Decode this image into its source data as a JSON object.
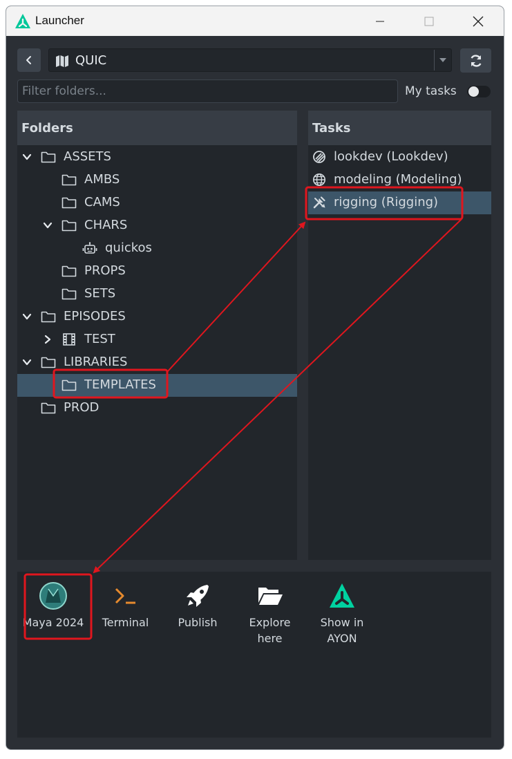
{
  "window": {
    "title": "Launcher"
  },
  "toolbar": {
    "project": "QUIC"
  },
  "filter": {
    "placeholder": "Filter folders...",
    "value": ""
  },
  "my_tasks": {
    "label": "My tasks",
    "enabled": false
  },
  "folders": {
    "header": "Folders",
    "items": [
      {
        "label": "ASSETS",
        "depth": 0,
        "expanded": true,
        "icon": "folder-icon"
      },
      {
        "label": "AMBS",
        "depth": 1,
        "icon": "folder-icon"
      },
      {
        "label": "CAMS",
        "depth": 1,
        "icon": "folder-icon"
      },
      {
        "label": "CHARS",
        "depth": 1,
        "expanded": true,
        "icon": "folder-icon"
      },
      {
        "label": "quickos",
        "depth": 2,
        "icon": "robot-icon"
      },
      {
        "label": "PROPS",
        "depth": 1,
        "icon": "folder-icon"
      },
      {
        "label": "SETS",
        "depth": 1,
        "icon": "folder-icon"
      },
      {
        "label": "EPISODES",
        "depth": 0,
        "expanded": true,
        "icon": "folder-icon"
      },
      {
        "label": "TEST",
        "depth": 1,
        "expanded": false,
        "icon": "film-icon"
      },
      {
        "label": "LIBRARIES",
        "depth": 0,
        "expanded": true,
        "icon": "folder-icon"
      },
      {
        "label": "TEMPLATES",
        "depth": 1,
        "selected": true,
        "icon": "folder-icon"
      },
      {
        "label": "PROD",
        "depth": 0,
        "icon": "folder-icon"
      }
    ]
  },
  "tasks": {
    "header": "Tasks",
    "items": [
      {
        "label": "lookdev (Lookdev)",
        "icon": "lookdev-icon"
      },
      {
        "label": "modeling (Modeling)",
        "icon": "globe-icon"
      },
      {
        "label": "rigging (Rigging)",
        "icon": "tools-icon",
        "selected": true
      }
    ]
  },
  "actions": {
    "items": [
      {
        "label": "Maya 2024",
        "icon": "maya-icon"
      },
      {
        "label": "Terminal",
        "icon": "terminal-icon"
      },
      {
        "label": "Publish",
        "icon": "rocket-icon"
      },
      {
        "label": "Explore here",
        "icon": "folder-open-icon"
      },
      {
        "label": "Show in AYON",
        "icon": "ayon-icon"
      }
    ]
  },
  "colors": {
    "window_bg": "#2b2f35",
    "panel_bg": "#22262b",
    "header_bg": "#373d45",
    "selection": "#3d5669",
    "accent": "#00d1a0",
    "annotation_red": "#e0161e"
  }
}
